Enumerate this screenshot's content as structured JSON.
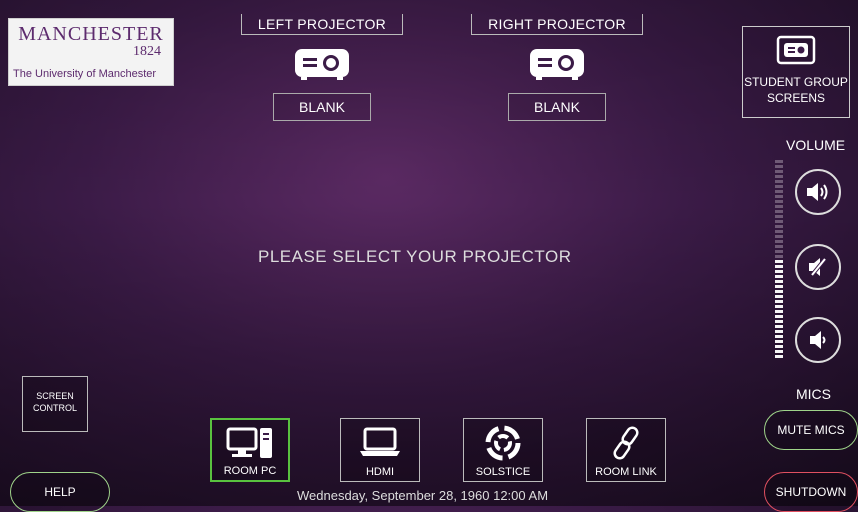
{
  "logo": {
    "name": "MANCHESTER",
    "year": "1824",
    "university": "The University of Manchester"
  },
  "projectors": {
    "left": {
      "title": "LEFT PROJECTOR",
      "blank_label": "BLANK"
    },
    "right": {
      "title": "RIGHT PROJECTOR",
      "blank_label": "BLANK"
    }
  },
  "student_group": {
    "label_line1": "STUDENT GROUP",
    "label_line2": "SCREENS"
  },
  "volume": {
    "label": "VOLUME",
    "level": 0.5
  },
  "main": {
    "prompt": "PLEASE SELECT YOUR PROJECTOR"
  },
  "mics": {
    "label": "MICS",
    "mute_label": "MUTE MICS"
  },
  "controls": {
    "screen_control_line1": "SCREEN",
    "screen_control_line2": "CONTROL",
    "help": "HELP",
    "shutdown": "SHUTDOWN"
  },
  "sources": [
    {
      "label": "ROOM PC",
      "icon": "desktop-pc-icon",
      "active": true
    },
    {
      "label": "HDMI",
      "icon": "laptop-icon",
      "active": false
    },
    {
      "label": "SOLSTICE",
      "icon": "solstice-swirl-icon",
      "active": false
    },
    {
      "label": "ROOM LINK",
      "icon": "link-icon",
      "active": false
    }
  ],
  "status": {
    "datetime": "Wednesday, September 28, 1960 12:00 AM"
  },
  "colors": {
    "active_green": "#59c23f",
    "shutdown_red": "#e05060",
    "brand_purple": "#5d2b6e"
  }
}
